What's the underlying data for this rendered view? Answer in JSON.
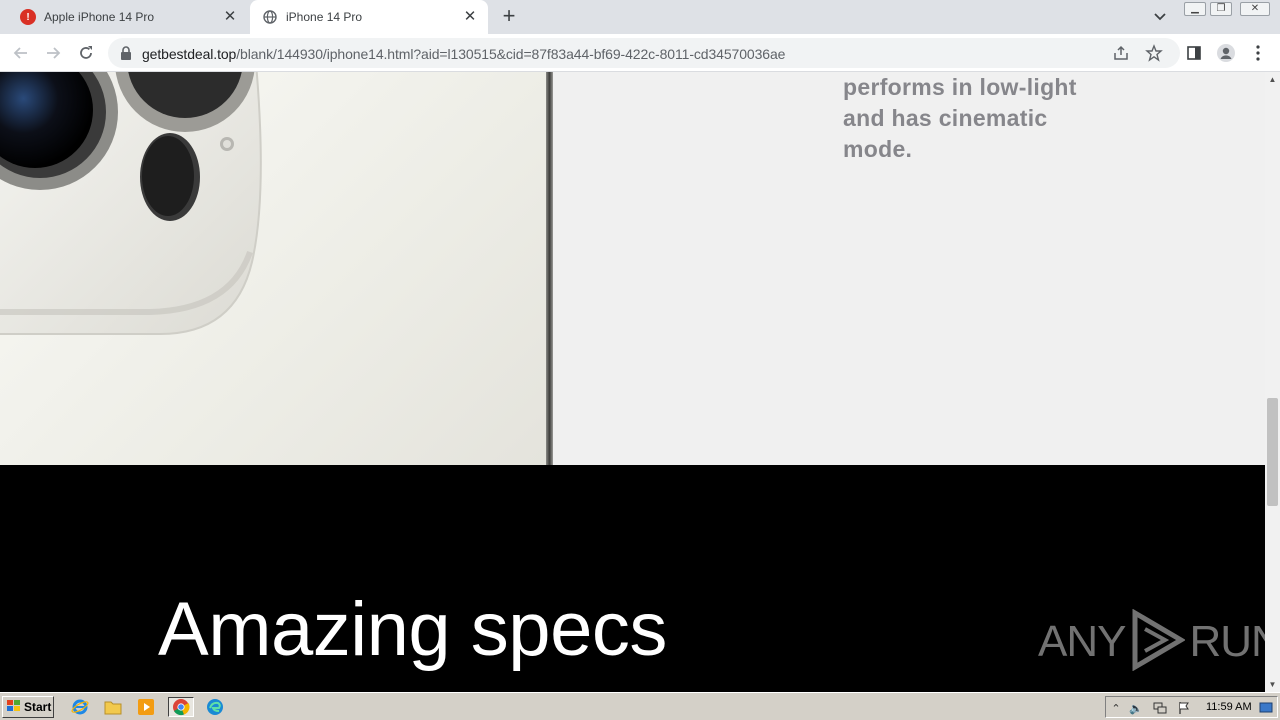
{
  "browser": {
    "tabs": [
      {
        "title": "Apple iPhone 14 Pro",
        "favicon": "alert-badge-icon",
        "badge": "!"
      },
      {
        "title": "iPhone 14 Pro",
        "favicon": "globe-icon"
      }
    ],
    "url_host": "getbestdeal.top",
    "url_path": "/blank/144930/iphone14.html?aid=l130515&cid=87f83a44-bf69-422c-8011-cd34570036ae"
  },
  "page": {
    "feature_text": [
      "performs in low-light",
      "and has cinematic",
      "mode."
    ],
    "section_heading": "Amazing specs",
    "watermark_left": "ANY",
    "watermark_right": "RUN"
  },
  "taskbar": {
    "start_label": "Start",
    "clock": "11:59 AM"
  },
  "colors": {
    "tab_strip": "#dee1e6",
    "feature_text": "#86868b",
    "specs_section_bg": "#000000",
    "alert_badge": "#d93025"
  }
}
